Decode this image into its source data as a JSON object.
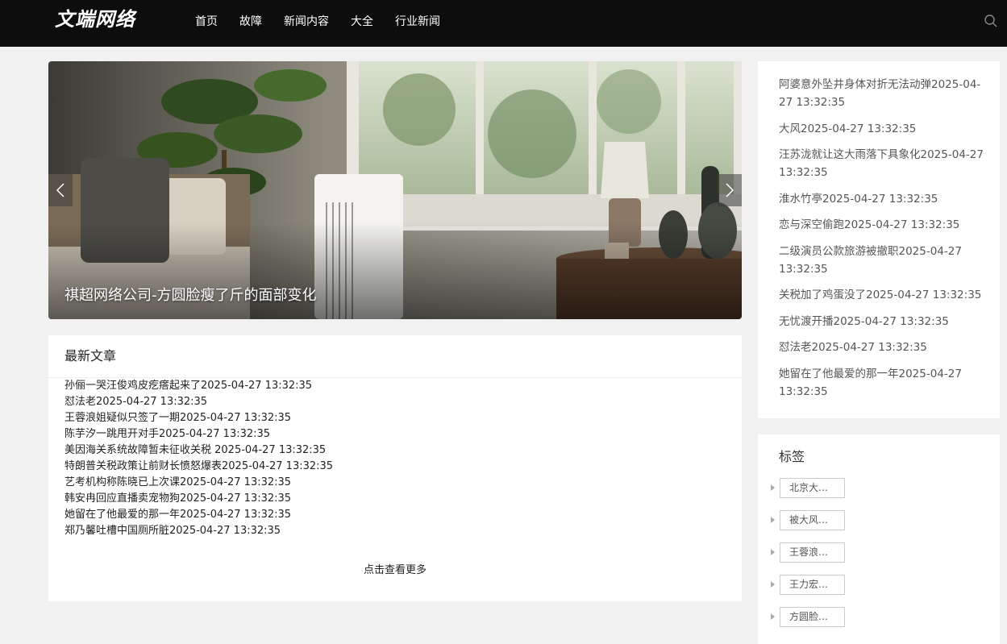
{
  "header": {
    "logo": "文端网络",
    "nav": [
      "首页",
      "故障",
      "新闻内容",
      "大全",
      "行业新闻"
    ],
    "search_icon": "search-icon"
  },
  "slider": {
    "caption": "祺超网络公司-方圆脸瘦了斤的面部变化",
    "prev_icon": "chevron-left-icon",
    "next_icon": "chevron-right-icon"
  },
  "latest": {
    "title": "最新文章",
    "items": [
      "孙俪一哭汪俊鸡皮疙瘩起来了2025-04-27 13:32:35",
      "怼法老2025-04-27 13:32:35",
      "王蓉浪姐疑似只签了一期2025-04-27 13:32:35",
      "陈芋汐一跳甩开对手2025-04-27 13:32:35",
      "美因海关系统故障暂未征收关税 2025-04-27 13:32:35",
      "特朗普关税政策让前财长愤怒爆表2025-04-27 13:32:35",
      "艺考机构称陈晓已上次课2025-04-27 13:32:35",
      "韩安冉回应直播卖宠物狗2025-04-27 13:32:35",
      "她留在了他最爱的那一年2025-04-27 13:32:35",
      "郑乃馨吐槽中国厕所脏2025-04-27 13:32:35"
    ],
    "more": "点击查看更多"
  },
  "sidebar": {
    "items": [
      "阿婆意外坠井身体对折无法动弹2025-04-27 13:32:35",
      "大风2025-04-27 13:32:35",
      "汪苏泷就让这大雨落下具象化2025-04-27 13:32:35",
      "淮水竹亭2025-04-27 13:32:35",
      "恋与深空偷跑2025-04-27 13:32:35",
      "二级演员公款旅游被撤职2025-04-27 13:32:35",
      "关税加了鸡蛋没了2025-04-27 13:32:35",
      "无忧渡开播2025-04-27 13:32:35",
      "怼法老2025-04-27 13:32:35",
      "她留在了他最爱的那一年2025-04-27 13:32:35"
    ]
  },
  "tags": {
    "title": "标签",
    "items": [
      "北京大…",
      "被大风…",
      "王蓉浪…",
      "王力宏…",
      "方圆脸…"
    ]
  },
  "colors": {
    "topbar": "#0d0d0d",
    "page_bg": "#f1f1f1"
  }
}
